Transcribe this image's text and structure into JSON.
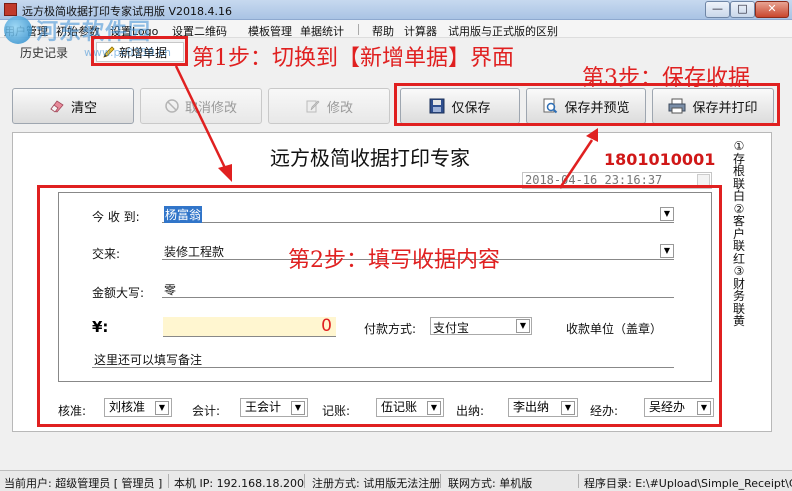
{
  "window": {
    "title": "远方极简收据打印专家试用版 V2018.4.16",
    "min_glyph": "—",
    "max_glyph": "□",
    "close_glyph": "✕"
  },
  "watermark": {
    "brand": "河东软件园",
    "url": "www.pc0359.cn"
  },
  "menu": {
    "items": [
      "用户管理",
      "初始参数",
      "设置Logo",
      "设置二维码",
      "模板管理",
      "单据统计",
      "帮助",
      "计算器",
      "试用版与正式版的区别"
    ]
  },
  "tabs": {
    "history": "历史记录",
    "new_receipt": "新增单据"
  },
  "toolbar": {
    "clear": "清空",
    "cancel_edit": "取消修改",
    "edit": "修改",
    "save_only": "仅保存",
    "save_preview": "保存并预览",
    "save_print": "保存并打印"
  },
  "annotations": {
    "step1": "第1步：切换到【新增单据】界面",
    "step2": "第2步：填写收据内容",
    "step3": "第3步：保存收据"
  },
  "receipt": {
    "title": "远方极简收据打印专家",
    "number": "1801010001",
    "datetime": "2018-04-16 23:16:37",
    "side_text": "①存根联白②客户联红③财务联黄",
    "received_from_label": "今 收 到:",
    "received_from_value": "杨富翁",
    "for_label": "交来:",
    "for_value": "装修工程款",
    "amount_words_label": "金额大写:",
    "amount_words_value": "零",
    "yen_label": "¥:",
    "amount_value": "0",
    "pay_method_label": "付款方式:",
    "pay_method_value": "支付宝",
    "payee_label": "收款单位（盖章）",
    "remark": "这里还可以填写备注"
  },
  "signers": {
    "approver_label": "核准:",
    "approver_value": "刘核准",
    "accountant_label": "会计:",
    "accountant_value": "王会计",
    "bookkeeper_label": "记账:",
    "bookkeeper_value": "伍记账",
    "cashier_label": "出纳:",
    "cashier_value": "李出纳",
    "handler_label": "经办:",
    "handler_value": "吴经办"
  },
  "status": {
    "user": "当前用户: 超级管理员 [ 管理员 ]",
    "ip": "本机 IP: 192.168.18.200",
    "register": "注册方式: 试用版无法注册",
    "network": "联网方式: 单机版",
    "directory": "程序目录: E:\\#Upload\\Simple_Receipt\\C"
  },
  "colors": {
    "annotation_red": "#e02020",
    "receipt_number": "#d01818",
    "selection_blue": "#3175c9",
    "amount_bg": "#fff6d0"
  }
}
